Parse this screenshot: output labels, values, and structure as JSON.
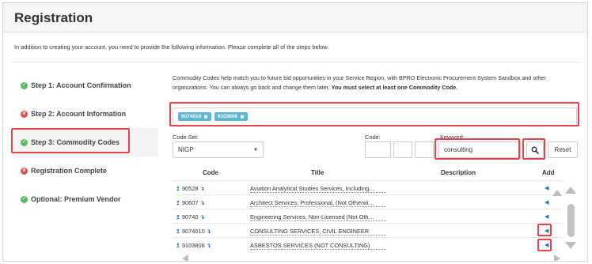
{
  "page": {
    "title": "Registration"
  },
  "intro": "In addition to creating your account, you need to provide the following information. Please complete all of the steps below.",
  "steps": [
    {
      "label": "Step 1: Account Confirmation",
      "status": "complete"
    },
    {
      "label": "Step 2: Account Information",
      "status": "error"
    },
    {
      "label": "Step 3: Commodity Codes",
      "status": "complete"
    },
    {
      "label": "Registration Complete",
      "status": "error"
    },
    {
      "label": "Optional: Premium Vendor",
      "status": "complete"
    }
  ],
  "commodity": {
    "description": "Commodity Codes help match you to future bid opportunities in your Service Region, with BPRO Electronic Procurement System Sandbox and other organizations. You can always go back and change them later.",
    "description_bold": "You must select at least one Commodity Code.",
    "selected_tags": [
      "9074010",
      "9103806"
    ],
    "code_set_label": "Code Set:",
    "code_set_value": "NIGP",
    "code_label": "Code:",
    "keyword_label": "Keyword:",
    "keyword_value": "consulting",
    "reset_label": "Reset",
    "columns": {
      "code": "Code",
      "title": "Title",
      "description": "Description",
      "add": "Add"
    },
    "rows": [
      {
        "code": "90528",
        "title": "Aviation Analytical Studies Services, Including…"
      },
      {
        "code": "90607",
        "title": "Architect Services, Professional, (Not Otherwi…"
      },
      {
        "code": "90740",
        "title": "Engineering Services, Non-Licensed (Not Oth…"
      },
      {
        "code": "9074010",
        "title": "CONSULTING SERVICES, CIVIL ENGINEER"
      },
      {
        "code": "9103806",
        "title": "ASBESTOS SERVICES (NOT CONSULTING)"
      }
    ]
  },
  "colors": {
    "highlight": "#e0454a",
    "tag": "#5bb6d6",
    "success": "#5cb85c",
    "error": "#d9534f",
    "link": "#2a6fb0"
  }
}
